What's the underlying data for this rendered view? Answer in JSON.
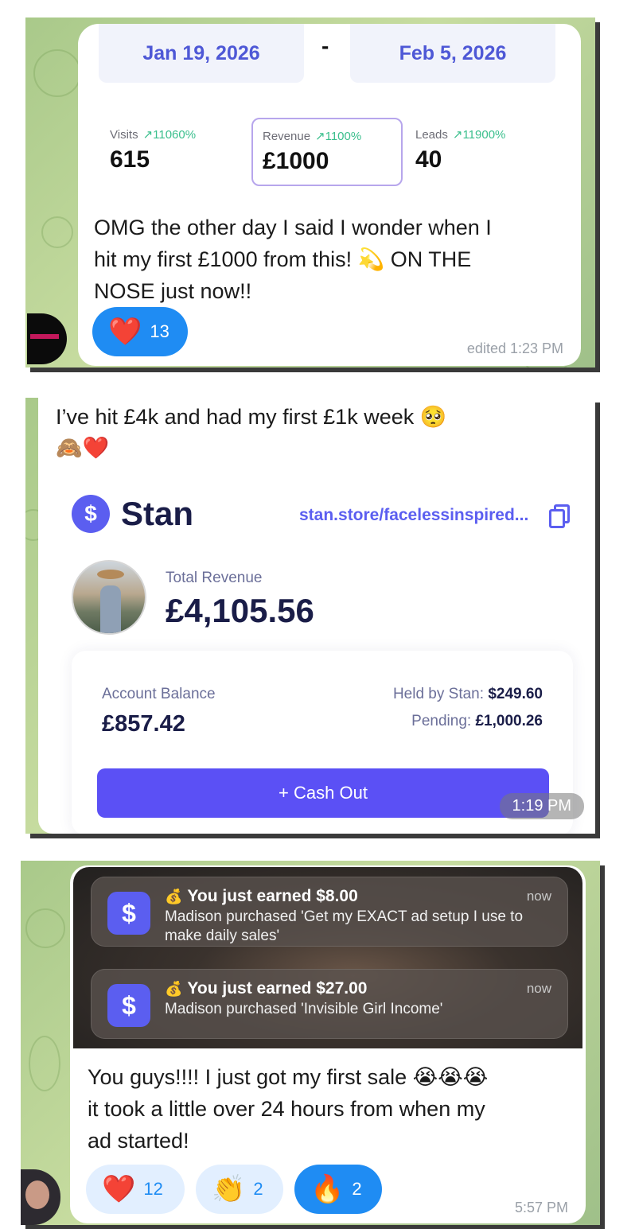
{
  "post1": {
    "date_start": "Jan 19, 2026",
    "date_sep": "-",
    "date_end": "Feb 5, 2026",
    "stats": [
      {
        "label": "Visits",
        "change": "↗11060%",
        "value": "615"
      },
      {
        "label": "Revenue",
        "change": "↗1100%",
        "value": "£1000"
      },
      {
        "label": "Leads",
        "change": "↗11900%",
        "value": "40"
      }
    ],
    "message_lines": [
      "OMG the other day I said I wonder when I",
      "hit my first £1000 from this! 💫 ON THE",
      "NOSE just now!!"
    ],
    "reaction": {
      "emoji": "❤️",
      "count": "13"
    },
    "timestamp": "edited 1:23 PM"
  },
  "post2": {
    "message_line1": "I’ve hit £4k and had my first £1k week 🥺",
    "message_line2": "🙈❤️",
    "brand_symbol": "$",
    "brand": "Stan",
    "store_url": "stan.store/facelessinspired...",
    "total_revenue_label": "Total Revenue",
    "total_revenue": "£4,105.56",
    "account_balance_label": "Account Balance",
    "account_balance": "£857.42",
    "held_label": "Held by Stan:",
    "held_value": "$249.60",
    "pending_label": "Pending:",
    "pending_value": "£1,000.26",
    "cashout_label": "+ Cash Out",
    "timestamp": "1:19 PM"
  },
  "post3": {
    "notifications": [
      {
        "title": "You just earned $8.00",
        "body": "Madison purchased 'Get my EXACT ad setup I use to make daily sales'",
        "time": "now"
      },
      {
        "title": "You just earned $27.00",
        "body": "Madison purchased 'Invisible Girl Income'",
        "time": "now"
      }
    ],
    "notif_bag_emoji": "💰",
    "app_symbol": "$",
    "message_lines": [
      "You guys!!!! I just got my first sale 😭😭😭",
      "it took a little over 24 hours from when my",
      "ad started!"
    ],
    "reactions": [
      {
        "emoji": "❤️",
        "count": "12"
      },
      {
        "emoji": "👏",
        "count": "2"
      },
      {
        "emoji": "🔥",
        "count": "2"
      }
    ],
    "timestamp": "5:57 PM"
  },
  "colors": {
    "accent_purple": "#5b5ef0",
    "date_blue": "#4e58d6",
    "positive_green": "#3bbf8d",
    "reaction_blue": "#1f8cf3",
    "panel_green": "#a9c98a"
  }
}
